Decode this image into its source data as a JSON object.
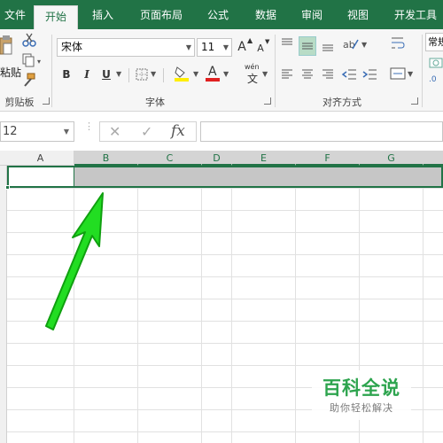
{
  "tabs": [
    {
      "label": "文件",
      "active": false
    },
    {
      "label": "开始",
      "active": true
    },
    {
      "label": "插入",
      "active": false
    },
    {
      "label": "页面布局",
      "active": false
    },
    {
      "label": "公式",
      "active": false
    },
    {
      "label": "数据",
      "active": false
    },
    {
      "label": "审阅",
      "active": false
    },
    {
      "label": "视图",
      "active": false
    },
    {
      "label": "开发工具",
      "active": false
    }
  ],
  "ribbon": {
    "clipboard": {
      "paste_label": "粘贴",
      "group_label": "剪贴板"
    },
    "font": {
      "font_name": "宋体",
      "font_size": "11",
      "bold": "B",
      "italic": "I",
      "underline": "U",
      "grow": "A",
      "shrink": "A",
      "font_color": "A",
      "phonetic": "wén",
      "group_label": "字体"
    },
    "alignment": {
      "group_label": "对齐方式"
    },
    "number": {
      "format": "常规"
    }
  },
  "formula_bar": {
    "name_box": "12",
    "cancel": "✕",
    "enter": "✓",
    "fx": "fx",
    "value": ""
  },
  "grid": {
    "columns": [
      "A",
      "B",
      "C",
      "D",
      "E",
      "F",
      "G"
    ],
    "selected_columns": [
      "B",
      "C",
      "D",
      "E",
      "F",
      "G"
    ]
  },
  "watermark": {
    "title": "百科全说",
    "subtitle": "助你轻松解决"
  },
  "colors": {
    "accent": "#217346",
    "arrow": "#22dd22",
    "selection": "#c6c6c6"
  }
}
